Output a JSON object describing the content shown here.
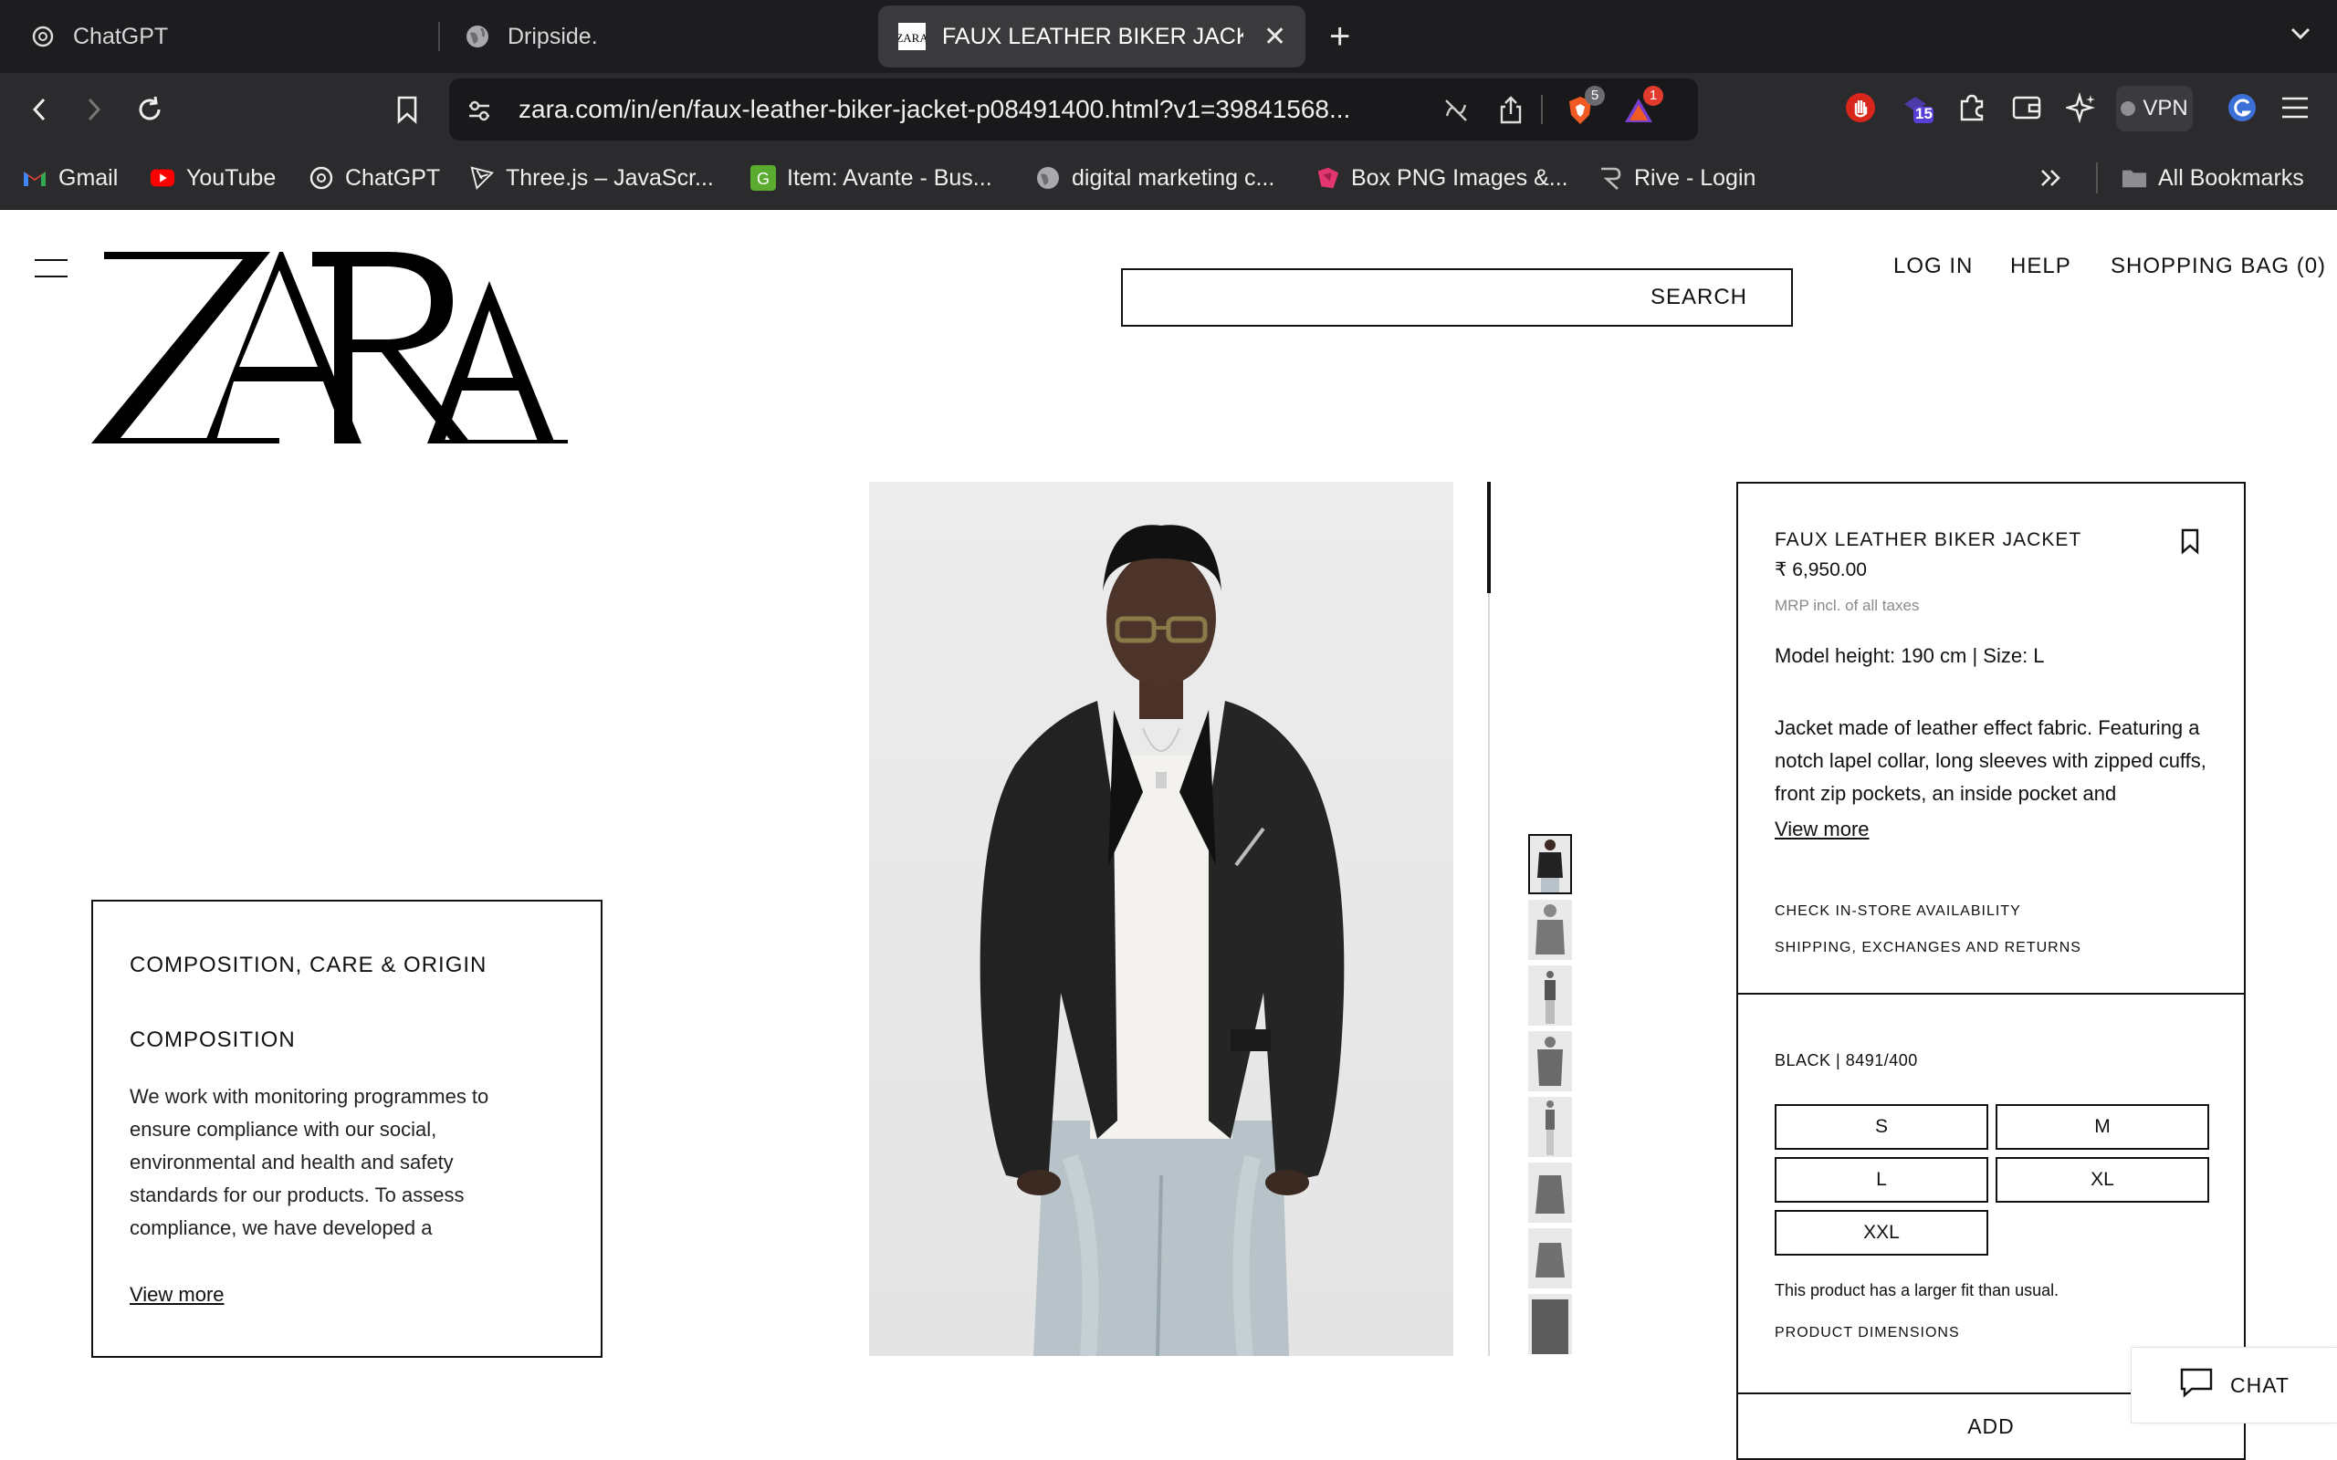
{
  "browser": {
    "tabs": [
      {
        "title": "ChatGPT",
        "icon": "chatgpt-icon"
      },
      {
        "title": "Dripside.",
        "icon": "globe-icon"
      },
      {
        "title": "FAUX LEATHER BIKER JACKE",
        "icon": "zara-favicon",
        "active": true
      }
    ],
    "url": "zara.com/in/en/faux-leather-biker-jacket-p08491400.html?v1=39841568...",
    "extension_badges": {
      "brave": "5",
      "alerts": "1",
      "counter": "15"
    },
    "vpn_label": "VPN",
    "bookmarks": [
      {
        "label": "Gmail",
        "icon": "gmail-icon"
      },
      {
        "label": "YouTube",
        "icon": "youtube-icon"
      },
      {
        "label": "ChatGPT",
        "icon": "chatgpt-icon"
      },
      {
        "label": "Three.js – JavaScr...",
        "icon": "threejs-icon"
      },
      {
        "label": "Item: Avante - Bus...",
        "icon": "g-icon"
      },
      {
        "label": "digital marketing c...",
        "icon": "globe-icon"
      },
      {
        "label": "Box PNG Images &...",
        "icon": "box-png-icon"
      },
      {
        "label": "Rive - Login",
        "icon": "rive-icon"
      }
    ],
    "all_bookmarks_label": "All Bookmarks",
    "colors": {
      "tabstrip": "#1d1d1f",
      "toolbar": "#2b2b2e",
      "brave_orange": "#f25a24"
    }
  },
  "site": {
    "logo_text": "ZARA",
    "search_label": "SEARCH",
    "nav": {
      "login": "LOG IN",
      "help": "HELP",
      "bag": "SHOPPING BAG (0)"
    }
  },
  "care": {
    "title": "COMPOSITION, CARE & ORIGIN",
    "subtitle": "COMPOSITION",
    "text": "We work with monitoring programmes to ensure compliance with our social, environmental and health and safety standards for our products. To assess compliance, we have developed a",
    "view_more": "View more"
  },
  "product": {
    "name": "FAUX LEATHER BIKER JACKET",
    "price": "₹ 6,950.00",
    "mrp_note": "MRP incl. of all taxes",
    "model_info": "Model height: 190 cm | Size: L",
    "description": "Jacket made of leather effect fabric. Featuring a notch lapel collar, long sleeves with zipped cuffs, front zip pockets, an inside pocket and",
    "view_more": "View more",
    "check_store": "CHECK IN-STORE AVAILABILITY",
    "shipping": "SHIPPING, EXCHANGES AND RETURNS",
    "color_ref": "BLACK | 8491/400",
    "sizes": [
      "S",
      "M",
      "L",
      "XL",
      "XXL"
    ],
    "fit_note": "This product has a larger fit than usual.",
    "dimensions": "PRODUCT DIMENSIONS",
    "add_label": "ADD"
  },
  "chat_label": "CHAT"
}
